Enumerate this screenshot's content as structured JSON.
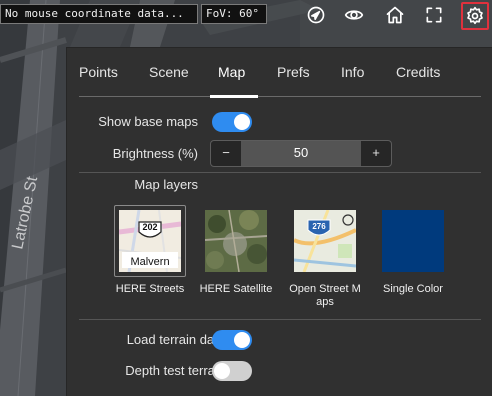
{
  "topbar": {
    "coord_text": "No mouse coordinate data...",
    "fov_text": "FoV: 60°"
  },
  "map_background": {
    "street_label": "Latrobe St"
  },
  "icons": [
    "navigate-icon",
    "eye-icon",
    "home-icon",
    "fullscreen-icon",
    "gear-icon"
  ],
  "colors": {
    "accent": "#2f8cf0",
    "settings_highlight": "#e0313d",
    "panel_bg": "#303030",
    "single_color_swatch": "#003a7d"
  },
  "tabs": [
    {
      "label": "Points"
    },
    {
      "label": "Scene"
    },
    {
      "label": "Map",
      "active": true
    },
    {
      "label": "Prefs"
    },
    {
      "label": "Info"
    },
    {
      "label": "Credits"
    }
  ],
  "map_tab": {
    "show_base_maps": {
      "label": "Show base maps",
      "on": true
    },
    "brightness": {
      "label": "Brightness (%)",
      "value": "50",
      "minus": "−",
      "plus": "+"
    },
    "map_layers_heading": "Map layers",
    "layers": [
      {
        "label": "HERE Streets",
        "selected": true,
        "thumb_badge": "202",
        "thumb_text": "Malvern"
      },
      {
        "label": "HERE Satellite",
        "selected": false
      },
      {
        "label": "Open Street Maps",
        "selected": false,
        "thumb_badge": "276"
      },
      {
        "label": "Single Color",
        "selected": false
      }
    ],
    "load_terrain": {
      "label": "Load terrain data",
      "on": true
    },
    "depth_test_terrain": {
      "label": "Depth test terrain",
      "on": false
    }
  }
}
